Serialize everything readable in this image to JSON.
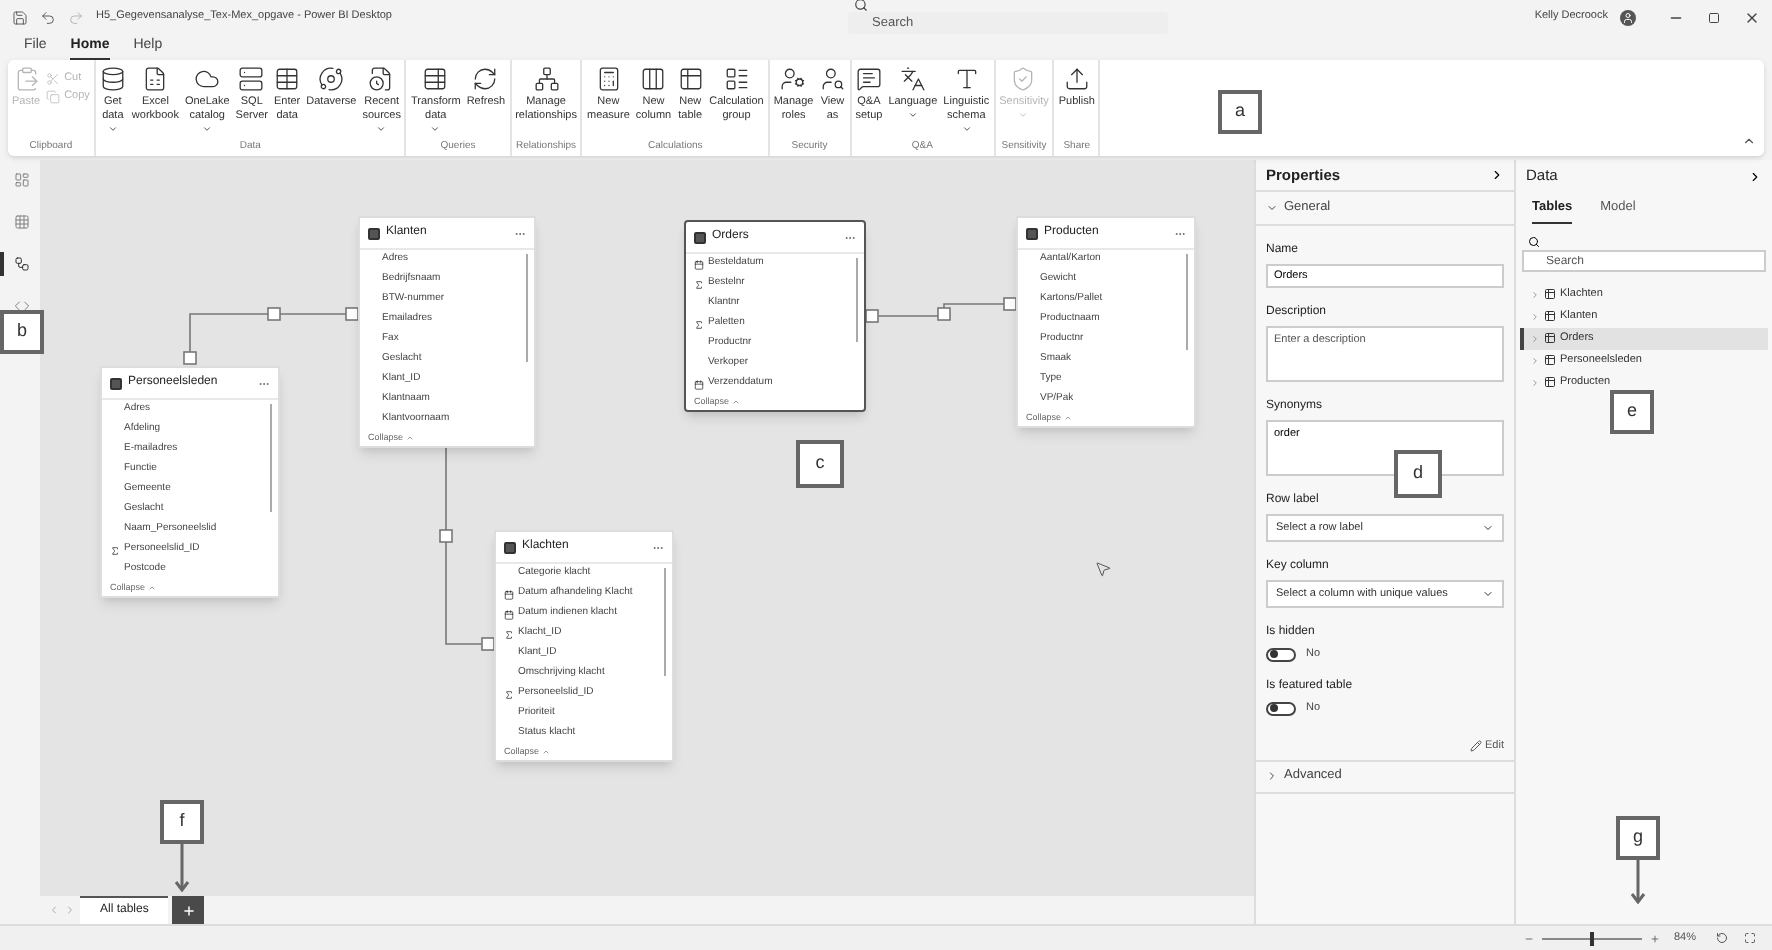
{
  "title_bar": {
    "title": "H5_Gegevensanalyse_Tex-Mex_opgave - Power BI Desktop",
    "search": {
      "placeholder": "Search"
    },
    "user": "Kelly Decroock"
  },
  "menu": [
    {
      "label": "File",
      "selected": false
    },
    {
      "label": "Home",
      "selected": true
    },
    {
      "label": "Help",
      "selected": false
    }
  ],
  "ribbon": [
    {
      "group": "Clipboard",
      "buttons": [
        {
          "label": "Paste",
          "kind": "large",
          "disabled": true,
          "dropdown": false
        },
        {
          "label": "Cut",
          "kind": "small",
          "disabled": true
        },
        {
          "label": "Copy",
          "kind": "small",
          "disabled": true
        }
      ]
    },
    {
      "group": "Data",
      "buttons": [
        {
          "label": "Get data",
          "kind": "large",
          "disabled": false,
          "dropdown": true
        },
        {
          "label": "Excel workbook",
          "kind": "large",
          "disabled": false,
          "dropdown": false
        },
        {
          "label": "OneLake catalog",
          "kind": "large",
          "disabled": false,
          "dropdown": true
        },
        {
          "label": "SQL Server",
          "kind": "large",
          "disabled": false,
          "dropdown": false
        },
        {
          "label": "Enter data",
          "kind": "large",
          "disabled": false,
          "dropdown": false
        },
        {
          "label": "Dataverse",
          "kind": "large",
          "disabled": false,
          "dropdown": false
        },
        {
          "label": "Recent sources",
          "kind": "large",
          "disabled": false,
          "dropdown": true
        }
      ]
    },
    {
      "group": "Queries",
      "buttons": [
        {
          "label": "Transform data",
          "kind": "large",
          "disabled": false,
          "dropdown": true
        },
        {
          "label": "Refresh",
          "kind": "large",
          "disabled": false,
          "dropdown": false
        }
      ]
    },
    {
      "group": "Relationships",
      "buttons": [
        {
          "label": "Manage relationships",
          "kind": "large",
          "disabled": false,
          "dropdown": false
        }
      ]
    },
    {
      "group": "Calculations",
      "buttons": [
        {
          "label": "New measure",
          "kind": "large",
          "disabled": false,
          "dropdown": false
        },
        {
          "label": "New column",
          "kind": "large",
          "disabled": false,
          "dropdown": false
        },
        {
          "label": "New table",
          "kind": "large",
          "disabled": false,
          "dropdown": false
        },
        {
          "label": "Calculation group",
          "kind": "large",
          "disabled": false,
          "dropdown": false
        }
      ]
    },
    {
      "group": "Security",
      "buttons": [
        {
          "label": "Manage roles",
          "kind": "large",
          "disabled": false,
          "dropdown": false
        },
        {
          "label": "View as",
          "kind": "large",
          "disabled": false,
          "dropdown": false
        }
      ]
    },
    {
      "group": "Q&A",
      "buttons": [
        {
          "label": "Q&A setup",
          "kind": "large",
          "disabled": false,
          "dropdown": false
        },
        {
          "label": "Language",
          "kind": "large",
          "disabled": false,
          "dropdown": true
        },
        {
          "label": "Linguistic schema",
          "kind": "large",
          "disabled": false,
          "dropdown": true
        }
      ]
    },
    {
      "group": "Sensitivity",
      "buttons": [
        {
          "label": "Sensitivity",
          "kind": "large",
          "disabled": true,
          "dropdown": true
        }
      ]
    },
    {
      "group": "Share",
      "buttons": [
        {
          "label": "Publish",
          "kind": "large",
          "disabled": false,
          "dropdown": false
        }
      ]
    }
  ],
  "rail": [
    {
      "selected": false
    },
    {
      "selected": false
    },
    {
      "selected": true
    },
    {
      "selected": false
    }
  ],
  "tables": [
    {
      "name": "Klanten",
      "selected": false,
      "collapse": "Collapse",
      "fields": [
        {
          "name": "Adres",
          "kind": "text"
        },
        {
          "name": "Bedrijfsnaam",
          "kind": "text"
        },
        {
          "name": "BTW-nummer",
          "kind": "text"
        },
        {
          "name": "Emailadres",
          "kind": "text"
        },
        {
          "name": "Fax",
          "kind": "text"
        },
        {
          "name": "Geslacht",
          "kind": "text"
        },
        {
          "name": "Klant_ID",
          "kind": "text"
        },
        {
          "name": "Klantnaam",
          "kind": "text"
        },
        {
          "name": "Klantvoornaam",
          "kind": "text"
        }
      ]
    },
    {
      "name": "Orders",
      "selected": true,
      "collapse": "Collapse",
      "fields": [
        {
          "name": "Besteldatum",
          "kind": "date"
        },
        {
          "name": "Bestelnr",
          "kind": "sum"
        },
        {
          "name": "Klantnr",
          "kind": "text"
        },
        {
          "name": "Paletten",
          "kind": "sum"
        },
        {
          "name": "Productnr",
          "kind": "text"
        },
        {
          "name": "Verkoper",
          "kind": "text"
        },
        {
          "name": "Verzenddatum",
          "kind": "date"
        }
      ]
    },
    {
      "name": "Producten",
      "selected": false,
      "collapse": "Collapse",
      "fields": [
        {
          "name": "Aantal/Karton",
          "kind": "text"
        },
        {
          "name": "Gewicht",
          "kind": "text"
        },
        {
          "name": "Kartons/Pallet",
          "kind": "text"
        },
        {
          "name": "Productnaam",
          "kind": "text"
        },
        {
          "name": "Productnr",
          "kind": "text"
        },
        {
          "name": "Smaak",
          "kind": "text"
        },
        {
          "name": "Type",
          "kind": "text"
        },
        {
          "name": "VP/Pak",
          "kind": "text"
        }
      ]
    },
    {
      "name": "Personeelsleden",
      "selected": false,
      "collapse": "Collapse",
      "fields": [
        {
          "name": "Adres",
          "kind": "text"
        },
        {
          "name": "Afdeling",
          "kind": "text"
        },
        {
          "name": "E-mailadres",
          "kind": "text"
        },
        {
          "name": "Functie",
          "kind": "text"
        },
        {
          "name": "Gemeente",
          "kind": "text"
        },
        {
          "name": "Geslacht",
          "kind": "text"
        },
        {
          "name": "Naam_Personeelslid",
          "kind": "text"
        },
        {
          "name": "Personeelslid_ID",
          "kind": "sum"
        },
        {
          "name": "Postcode",
          "kind": "text"
        }
      ]
    },
    {
      "name": "Klachten",
      "selected": false,
      "collapse": "Collapse",
      "fields": [
        {
          "name": "Categorie klacht",
          "kind": "text"
        },
        {
          "name": "Datum afhandeling Klacht",
          "kind": "date"
        },
        {
          "name": "Datum indienen klacht",
          "kind": "date"
        },
        {
          "name": "Klacht_ID",
          "kind": "sum"
        },
        {
          "name": "Klant_ID",
          "kind": "text"
        },
        {
          "name": "Omschrijving klacht",
          "kind": "text"
        },
        {
          "name": "Personeelslid_ID",
          "kind": "sum"
        },
        {
          "name": "Prioriteit",
          "kind": "text"
        },
        {
          "name": "Status klacht",
          "kind": "text"
        }
      ]
    }
  ],
  "page_tabs": [
    {
      "label": "All tables",
      "selected": true
    }
  ],
  "properties": {
    "title": "Properties",
    "general": {
      "label": "General",
      "expanded": true
    },
    "name": {
      "label": "Name",
      "value": "Orders"
    },
    "description": {
      "label": "Description",
      "placeholder": "Enter a description"
    },
    "synonyms": {
      "label": "Synonyms",
      "value": "order"
    },
    "row_label": {
      "label": "Row label",
      "placeholder": "Select a row label"
    },
    "key_column": {
      "label": "Key column",
      "placeholder": "Select a column with unique values"
    },
    "toggles": [
      {
        "label": "Is hidden",
        "on": false,
        "state_text": "No"
      },
      {
        "label": "Is featured table",
        "on": false,
        "state_text": "No"
      }
    ],
    "edit": "Edit",
    "advanced": {
      "label": "Advanced",
      "expanded": false
    }
  },
  "data_pane": {
    "title": "Data",
    "tabs": [
      {
        "label": "Tables",
        "selected": true
      },
      {
        "label": "Model",
        "selected": false
      }
    ],
    "search": {
      "placeholder": "Search"
    },
    "tables": [
      {
        "name": "Klachten",
        "selected": false
      },
      {
        "name": "Klanten",
        "selected": false
      },
      {
        "name": "Orders",
        "selected": true
      },
      {
        "name": "Personeelsleden",
        "selected": false
      },
      {
        "name": "Producten",
        "selected": false
      }
    ]
  },
  "status_bar": {
    "zoom": {
      "level": 0.5,
      "reading": "84%"
    }
  },
  "callouts": [
    {
      "letter": "a",
      "arrow": false
    },
    {
      "letter": "b",
      "arrow": false
    },
    {
      "letter": "c",
      "arrow": false
    },
    {
      "letter": "d",
      "arrow": false
    },
    {
      "letter": "e",
      "arrow": false
    },
    {
      "letter": "f",
      "arrow": true
    },
    {
      "letter": "g",
      "arrow": true
    }
  ]
}
